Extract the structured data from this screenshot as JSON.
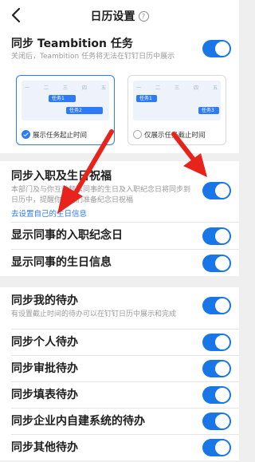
{
  "header": {
    "title": "日历设置",
    "help_icon": "question-circle-icon",
    "back_icon": "chevron-left-icon"
  },
  "teambition": {
    "label": "同步 Teambition 任务",
    "desc": "关闭后，Teambition 任务将无法在钉钉日历中展示",
    "toggle_on": true,
    "weekdays": [
      "一",
      "二",
      "三",
      "四",
      "五"
    ],
    "task1": "任务1",
    "task2": "任务2",
    "task3": "任务3",
    "option1": "展示任务起止时间",
    "option2": "仅展示任务截止时间",
    "selected_option": 1
  },
  "birthday_sync": {
    "label": "同步入职及生日祝福",
    "desc": "本部门及与你互动频繁同事的生日及入职纪念日将同步到日历中，提醒你给他们准备纪念日祝福",
    "link": "去设置自己的生日信息",
    "toggle_on": true
  },
  "anniversary": {
    "label": "显示同事的入职纪念日",
    "toggle_on": true
  },
  "colleague_birthday": {
    "label": "显示同事的生日信息",
    "toggle_on": true
  },
  "todo_sync": {
    "label": "同步我的待办",
    "desc": "有设置截止时间的待办可以在钉钉日历中展示和完成",
    "toggle_on": true
  },
  "todo_items": [
    {
      "label": "同步个人待办",
      "toggle_on": true
    },
    {
      "label": "同步审批待办",
      "toggle_on": true
    },
    {
      "label": "同步填表待办",
      "toggle_on": true
    },
    {
      "label": "同步企业内自建系统的待办",
      "toggle_on": true
    },
    {
      "label": "同步其他待办",
      "toggle_on": true
    }
  ],
  "colors": {
    "accent": "#1976e6",
    "arrow": "#e8231b"
  }
}
